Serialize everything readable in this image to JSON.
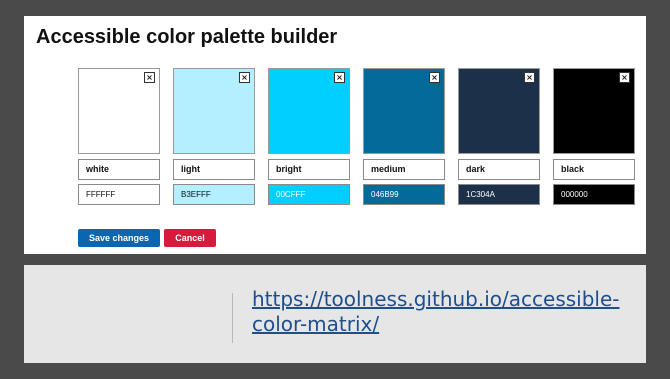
{
  "title": "Accessible color palette builder",
  "palette": [
    {
      "name": "white",
      "hex": "FFFFFF",
      "color": "#FFFFFF",
      "text_color": "#111111"
    },
    {
      "name": "light",
      "hex": "B3EFFF",
      "color": "#B3EFFF",
      "text_color": "#111111"
    },
    {
      "name": "bright",
      "hex": "00CFFF",
      "color": "#00CFFF",
      "text_color": "#ffffff"
    },
    {
      "name": "medium",
      "hex": "046B99",
      "color": "#046B99",
      "text_color": "#ffffff"
    },
    {
      "name": "dark",
      "hex": "1C304A",
      "color": "#1C304A",
      "text_color": "#ffffff"
    },
    {
      "name": "black",
      "hex": "000000",
      "color": "#000000",
      "text_color": "#ffffff"
    }
  ],
  "remove_glyph": "×",
  "buttons": {
    "save": "Save changes",
    "cancel": "Cancel"
  },
  "link": {
    "text": "https://toolness.github.io/accessible-color-matrix/"
  }
}
